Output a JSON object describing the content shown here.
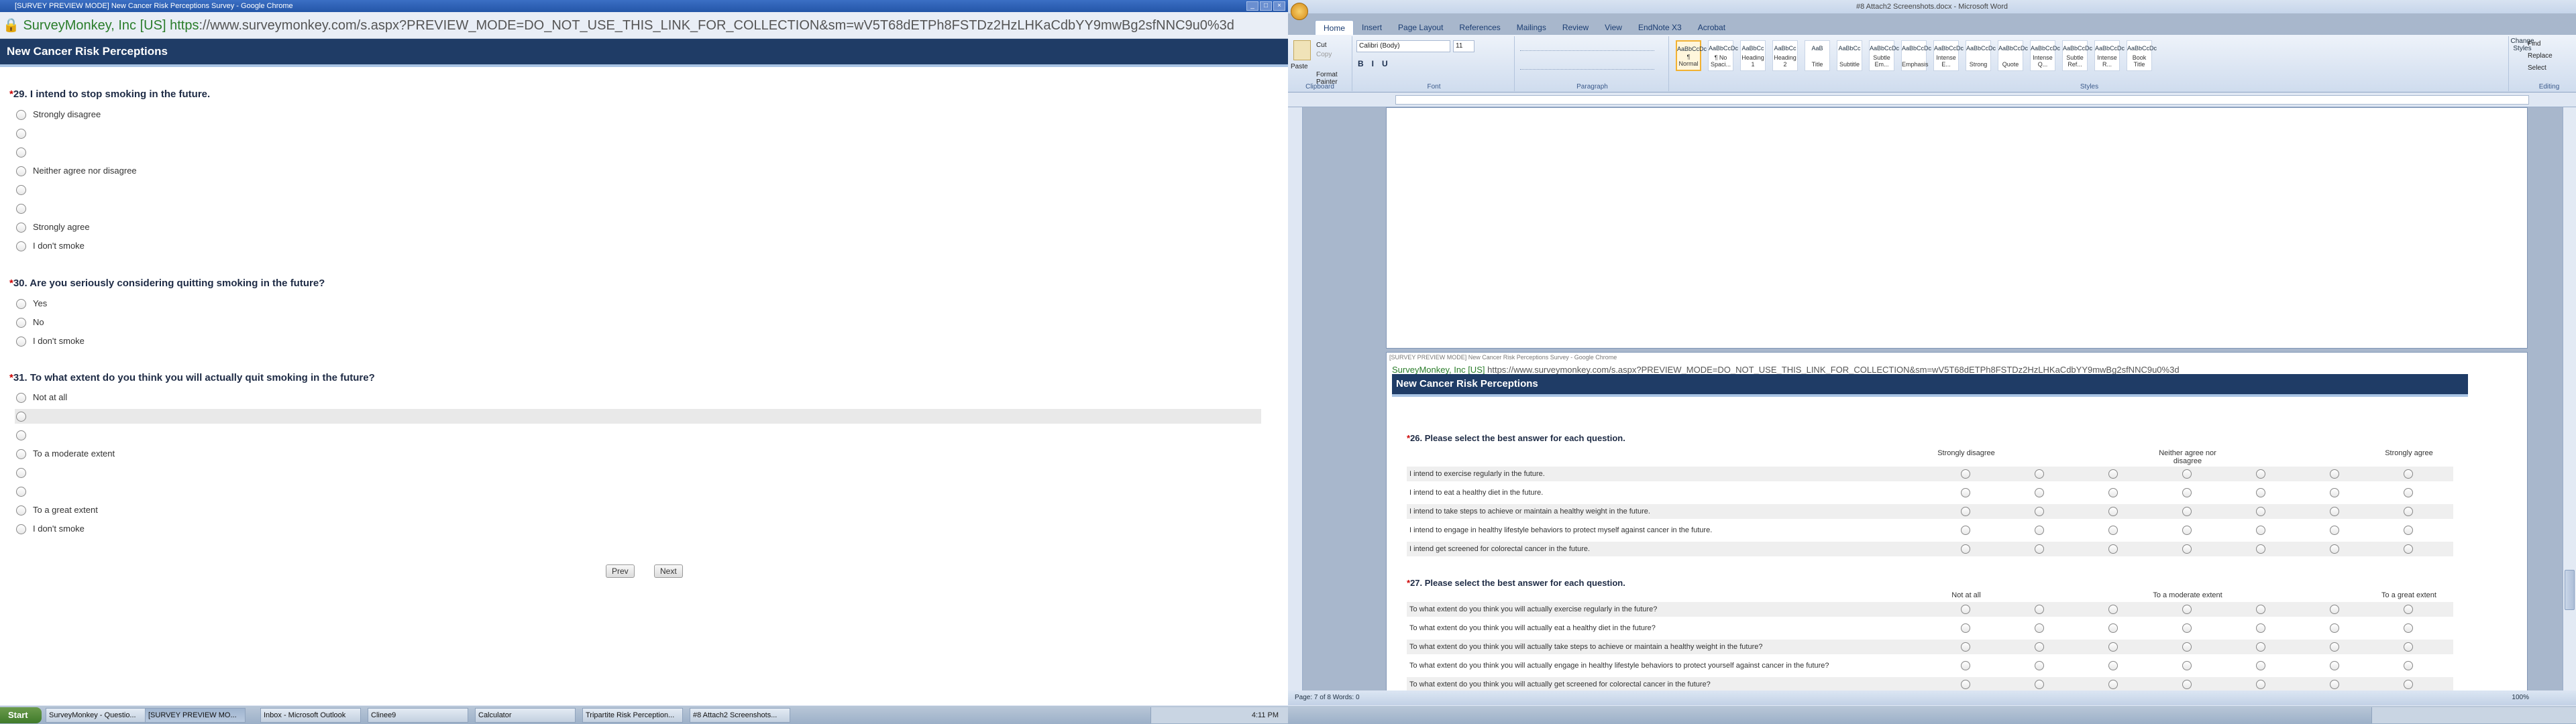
{
  "chrome": {
    "title": "[SURVEY PREVIEW MODE] New Cancer Risk Perceptions Survey - Google Chrome",
    "url_sec": "SurveyMonkey, Inc [US]",
    "url_https": "https",
    "url_rest": "://www.surveymonkey.com/s.aspx?PREVIEW_MODE=DO_NOT_USE_THIS_LINK_FOR_COLLECTION&sm=wV5T68dETPh8FSTDz2HzLHKaCdbYY9mwBg2sfNNC9u0%3d",
    "survey_title": "New Cancer Risk Perceptions",
    "q29": {
      "star": "*",
      "text": "29. I intend to stop smoking in the future.",
      "options": [
        "Strongly disagree",
        "",
        "",
        "Neither agree nor disagree",
        "",
        "",
        "Strongly agree",
        "I don't smoke"
      ]
    },
    "q30": {
      "star": "*",
      "text": "30. Are you seriously considering quitting smoking in the future?",
      "options": [
        "Yes",
        "No",
        "I don't smoke"
      ]
    },
    "q31": {
      "star": "*",
      "text": "31. To what extent do you think you will actually quit smoking in the future?",
      "options": [
        "Not at all",
        "",
        "",
        "To a moderate extent",
        "",
        "",
        "To a great extent",
        "I don't smoke"
      ]
    },
    "prev": "Prev",
    "next": "Next"
  },
  "taskbar": {
    "start": "Start",
    "items": [
      "SurveyMonkey - Questio...",
      "[SURVEY PREVIEW MO...",
      "Inbox - Microsoft Outlook",
      "Clinee9",
      "Calculator",
      "Tripartite Risk Perception...",
      "#8 Attach2 Screenshots..."
    ],
    "time": "4:11 PM"
  },
  "word": {
    "title": "#8 Attach2 Screenshots.docx - Microsoft Word",
    "tabs": [
      "Home",
      "Insert",
      "Page Layout",
      "References",
      "Mailings",
      "Review",
      "View",
      "EndNote X3",
      "Acrobat"
    ],
    "clipboard": {
      "paste": "Paste",
      "cut": "Cut",
      "copy": "Copy",
      "format_painter": "Format Painter",
      "label": "Clipboard"
    },
    "font": {
      "name": "Calibri (Body)",
      "size": "11",
      "label": "Font"
    },
    "paragraph_label": "Paragraph",
    "styles_label": "Styles",
    "editing": {
      "find": "Find",
      "replace": "Replace",
      "select": "Select",
      "label": "Editing"
    },
    "change_styles": "Change Styles",
    "styles": [
      {
        "sample": "AaBbCcDc",
        "name": "¶ Normal"
      },
      {
        "sample": "AaBbCcDc",
        "name": "¶ No Spaci..."
      },
      {
        "sample": "AaBbCc",
        "name": "Heading 1"
      },
      {
        "sample": "AaBbCc",
        "name": "Heading 2"
      },
      {
        "sample": "AaB",
        "name": "Title"
      },
      {
        "sample": "AaBbCc",
        "name": "Subtitle"
      },
      {
        "sample": "AaBbCcDc",
        "name": "Subtle Em..."
      },
      {
        "sample": "AaBbCcDc",
        "name": "Emphasis"
      },
      {
        "sample": "AaBbCcDc",
        "name": "Intense E..."
      },
      {
        "sample": "AaBbCcDc",
        "name": "Strong"
      },
      {
        "sample": "AaBbCcDc",
        "name": "Quote"
      },
      {
        "sample": "AaBbCcDc",
        "name": "Intense Q..."
      },
      {
        "sample": "AaBbCcDc",
        "name": "Subtle Ref..."
      },
      {
        "sample": "AaBbCcDc",
        "name": "Intense R..."
      },
      {
        "sample": "AaBbCcDc",
        "name": "Book Title"
      }
    ],
    "status": "Page: 7 of 8    Words: 0",
    "zoom": "100%"
  },
  "embedded": {
    "title": "[SURVEY PREVIEW MODE] New Cancer Risk Perceptions Survey - Google Chrome",
    "url_sec": "SurveyMonkey, Inc [US]",
    "url_rest": "https://www.surveymonkey.com/s.aspx?PREVIEW_MODE=DO_NOT_USE_THIS_LINK_FOR_COLLECTION&sm=wV5T68dETPh8FSTDz2HzLHKaCdbYY9mwBg2sfNNC9u0%3d",
    "survey_title": "New Cancer Risk Perceptions",
    "q26": {
      "star": "*",
      "text": "26. Please select the best answer for each question.",
      "headers": [
        "Strongly disagree",
        "",
        "",
        "Neither agree nor disagree",
        "",
        "",
        "Strongly agree"
      ],
      "rows": [
        "I intend to exercise regularly in the future.",
        "I intend to eat a healthy diet in the future.",
        "I intend to take steps to achieve or maintain a healthy weight in the future.",
        "I intend to engage in healthy lifestyle behaviors to protect myself against cancer in the future.",
        "I intend get screened for colorectal cancer in the future."
      ]
    },
    "q27": {
      "star": "*",
      "text": "27. Please select the best answer for each question.",
      "headers": [
        "Not at all",
        "",
        "",
        "To a moderate extent",
        "",
        "",
        "To a great extent"
      ],
      "rows": [
        "To what extent do you think you will actually exercise regularly in the future?",
        "To what extent do you think you will actually eat a healthy diet in the future?",
        "To what extent do you think you will actually take steps to achieve or maintain a healthy weight in the future?",
        "To what extent do you think you will actually engage in healthy lifestyle behaviors to protect yourself against cancer in the future?",
        "To what extent do you think you will actually get screened for colorectal cancer in the future?"
      ]
    }
  }
}
